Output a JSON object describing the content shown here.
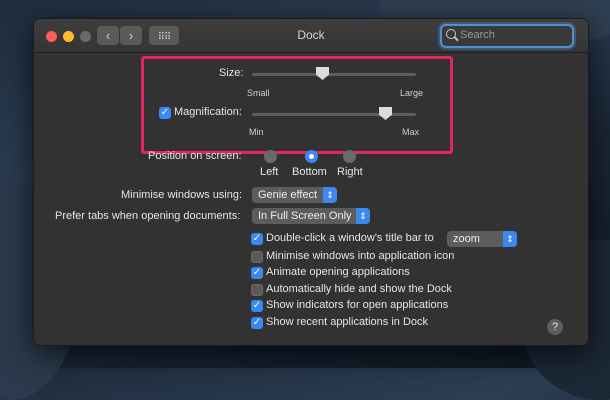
{
  "window": {
    "title": "Dock"
  },
  "search": {
    "placeholder": "Search"
  },
  "size": {
    "label": "Size:",
    "min_label": "Small",
    "max_label": "Large",
    "value": 0.42
  },
  "magnification": {
    "label": "Magnification:",
    "checked": true,
    "min_label": "Min",
    "max_label": "Max",
    "value": 0.82
  },
  "position": {
    "label": "Position on screen:",
    "options": [
      "Left",
      "Bottom",
      "Right"
    ],
    "selected": "Bottom"
  },
  "minimise": {
    "label": "Minimise windows using:",
    "value": "Genie effect"
  },
  "tabs": {
    "label": "Prefer tabs when opening documents:",
    "value": "In Full Screen Only"
  },
  "checkboxes": [
    {
      "label": "Double-click a window's title bar to",
      "checked": true
    },
    {
      "label": "Minimise windows into application icon",
      "checked": false
    },
    {
      "label": "Animate opening applications",
      "checked": true
    },
    {
      "label": "Automatically hide and show the Dock",
      "checked": false
    },
    {
      "label": "Show indicators for open applications",
      "checked": true
    },
    {
      "label": "Show recent applications in Dock",
      "checked": true
    }
  ],
  "double_click_action": "zoom",
  "help": "?",
  "colors": {
    "accent": "#3b88f0",
    "highlight": "#e5265d"
  }
}
